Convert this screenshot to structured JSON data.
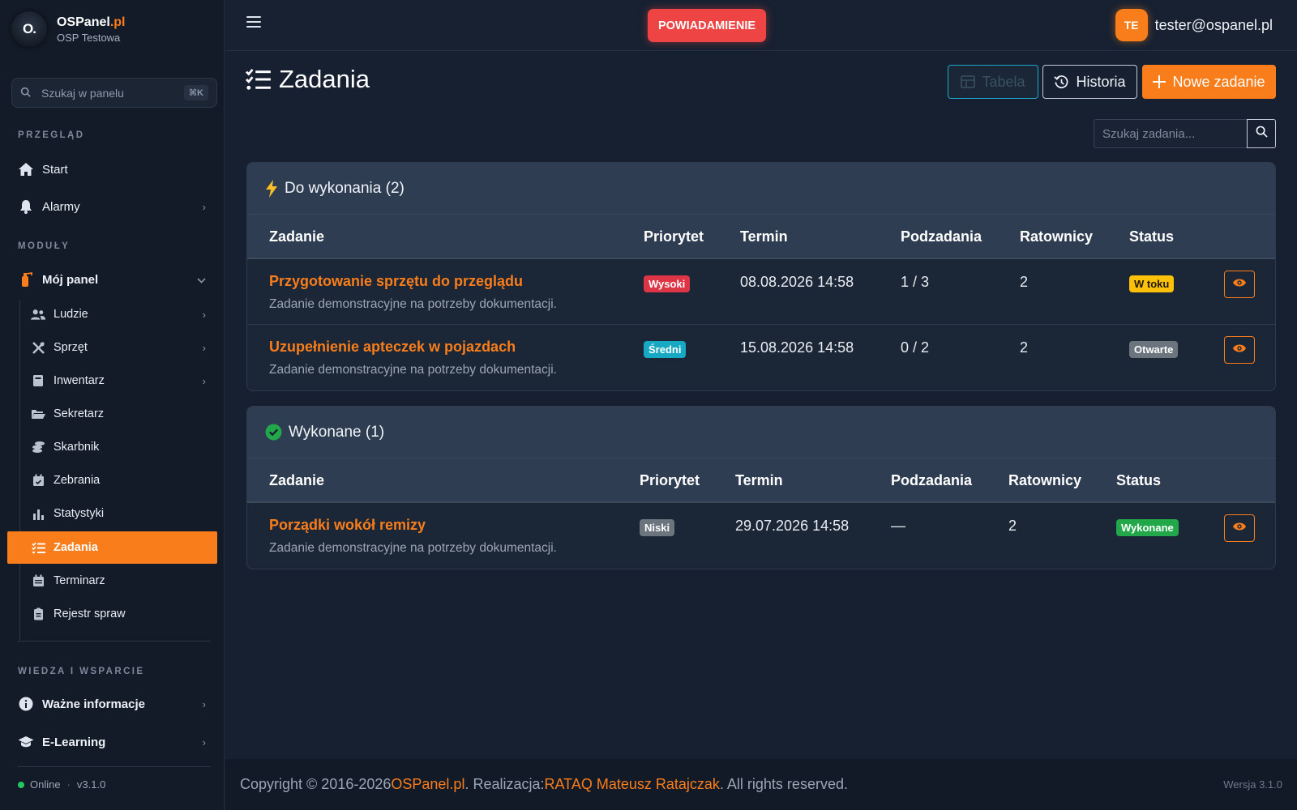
{
  "brand": {
    "logo_text": "O.",
    "name": "OSPanel",
    "name_suffix": ".pl",
    "subtitle": "OSP Testowa"
  },
  "sidebar": {
    "search_placeholder": "Szukaj w panelu",
    "search_shortcut": "⌘K",
    "sections": {
      "overview": "PRZEGLĄD",
      "modules": "MODUŁY",
      "knowledge": "WIEDZA I WSPARCIE"
    },
    "overview_items": [
      {
        "label": "Start"
      },
      {
        "label": "Alarmy"
      }
    ],
    "module_parent": "Mój panel",
    "sub_items": [
      {
        "label": "Ludzie"
      },
      {
        "label": "Sprzęt"
      },
      {
        "label": "Inwentarz"
      },
      {
        "label": "Sekretarz"
      },
      {
        "label": "Skarbnik"
      },
      {
        "label": "Zebrania"
      },
      {
        "label": "Statystyki"
      },
      {
        "label": "Zadania"
      },
      {
        "label": "Terminarz"
      },
      {
        "label": "Rejestr spraw"
      }
    ],
    "knowledge_items": [
      {
        "label": "Ważne informacje"
      },
      {
        "label": "E-Learning"
      }
    ],
    "footer": {
      "status": "Online",
      "version": "v3.1.0"
    }
  },
  "topbar": {
    "notify_label": "POWIADAMIENIE",
    "user_initials": "TE",
    "user_email": "tester@ospanel.pl"
  },
  "page": {
    "title": "Zadania",
    "buttons": {
      "table": "Tabela",
      "history": "Historia",
      "new_task": "Nowe zadanie"
    },
    "search_placeholder": "Szukaj zadania..."
  },
  "columns": {
    "task": "Zadanie",
    "priority": "Priorytet",
    "deadline": "Termin",
    "subtasks": "Podzadania",
    "rescuers": "Ratownicy",
    "status": "Status"
  },
  "todo": {
    "header": "Do wykonania (2)",
    "rows": [
      {
        "name": "Przygotowanie sprzętu do przeglądu",
        "desc": "Zadanie demonstracyjne na potrzeby dokumentacji.",
        "priority": "Wysoki",
        "deadline": "08.08.2026 14:58",
        "subtasks": "1 / 3",
        "rescuers": "2",
        "status": "W toku"
      },
      {
        "name": "Uzupełnienie apteczek w pojazdach",
        "desc": "Zadanie demonstracyjne na potrzeby dokumentacji.",
        "priority": "Średni",
        "deadline": "15.08.2026 14:58",
        "subtasks": "0 / 2",
        "rescuers": "2",
        "status": "Otwarte"
      }
    ]
  },
  "done": {
    "header": "Wykonane (1)",
    "rows": [
      {
        "name": "Porządki wokół remizy",
        "desc": "Zadanie demonstracyjne na potrzeby dokumentacji.",
        "priority": "Niski",
        "deadline": "29.07.2026 14:58",
        "subtasks": "—",
        "rescuers": "2",
        "status": "Wykonane"
      }
    ]
  },
  "footer": {
    "copyright": "Copyright © 2016-2026 ",
    "brand_link": "OSPanel.pl",
    "realization": ". Realizacja: ",
    "author_link": "RATAQ Mateusz Ratajczak",
    "rights": ". All rights reserved.",
    "version": "Wersja 3.1.0"
  },
  "colors": {
    "accent": "#f97d1a",
    "danger": "#ef4444",
    "success": "#22a84a",
    "warning": "#ffc107",
    "info": "#17a8c4"
  },
  "icons": {
    "search": "search-icon",
    "home": "home-icon",
    "bell": "bell-icon",
    "extinguisher": "extinguisher-icon",
    "tasks": "tasks-icon",
    "eye": "eye-icon",
    "bolt": "bolt-icon",
    "check_circle": "check-circle-icon"
  }
}
